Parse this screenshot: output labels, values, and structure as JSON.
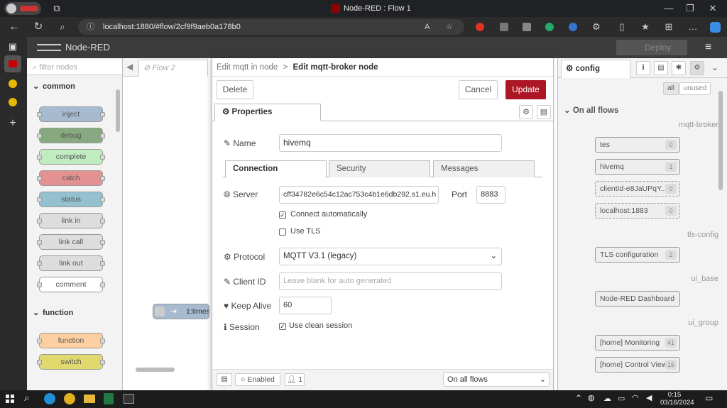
{
  "browser": {
    "title": "Node-RED : Flow 1",
    "url": "localhost:1880/#flow/2cf9f9aeb0a178b0",
    "colors": {
      "chrome": "#202124"
    }
  },
  "header": {
    "app_name": "Node-RED",
    "deploy_label": "Deploy"
  },
  "palette": {
    "filter_placeholder": "filter nodes",
    "categories": [
      "common",
      "function"
    ],
    "common_nodes": [
      {
        "label": "inject",
        "color": "#a6bbcf"
      },
      {
        "label": "debug",
        "color": "#87a980"
      },
      {
        "label": "complete",
        "color": "#c0edc0"
      },
      {
        "label": "catch",
        "color": "#e49191"
      },
      {
        "label": "status",
        "color": "#94c1d0"
      },
      {
        "label": "link in",
        "color": "#dddddd"
      },
      {
        "label": "link call",
        "color": "#dddddd"
      },
      {
        "label": "link out",
        "color": "#dddddd"
      },
      {
        "label": "comment",
        "color": "#ffffff"
      }
    ],
    "function_nodes": [
      {
        "label": "function",
        "color": "#fdd0a2"
      },
      {
        "label": "switch",
        "color": "#e2d96e"
      }
    ]
  },
  "workspace": {
    "tab_label": "Flow 2",
    "node_label": "1:times"
  },
  "tray": {
    "breadcrumb_parent": "Edit mqtt in node",
    "breadcrumb_sep": ">",
    "breadcrumb_current": "Edit mqtt-broker node",
    "delete_label": "Delete",
    "cancel_label": "Cancel",
    "update_label": "Update",
    "properties_tab": "Properties",
    "name_label": "Name",
    "name_value": "hivemq",
    "tabs": [
      "Connection",
      "Security",
      "Messages"
    ],
    "server_label": "Server",
    "server_value": "cff34782e6c54c12ac753c4b1e6db292.s1.eu.h",
    "port_label": "Port",
    "port_value": "8883",
    "connect_auto_label": "Connect automatically",
    "use_tls_label": "Use TLS",
    "protocol_label": "Protocol",
    "protocol_value": "MQTT V3.1 (legacy)",
    "client_id_label": "Client ID",
    "client_id_placeholder": "Leave blank for auto generated",
    "keep_alive_label": "Keep Alive",
    "keep_alive_value": "60",
    "session_label": "Session",
    "clean_session_label": "Use clean session",
    "footer": {
      "enabled_label": "Enabled",
      "users_count": "1",
      "scope": "On all flows"
    }
  },
  "sidebar": {
    "tab_label": "config",
    "filter_all": "all",
    "filter_unused": "unused",
    "section_title": "On all flows",
    "groups": [
      {
        "name": "mqtt-broker",
        "nodes": [
          {
            "label": "tes",
            "count": "0",
            "dashed": false
          },
          {
            "label": "hivemq",
            "count": "1",
            "dashed": false
          },
          {
            "label": "clientId-e8JaUPqY...",
            "count": "0",
            "dashed": true
          },
          {
            "label": "localhost:1883",
            "count": "0",
            "dashed": true
          }
        ]
      },
      {
        "name": "tls-config",
        "nodes": [
          {
            "label": "TLS configuration",
            "count": "2",
            "dashed": false
          }
        ]
      },
      {
        "name": "ui_base",
        "nodes": [
          {
            "label": "Node-RED Dashboard",
            "count": "",
            "dashed": false
          }
        ]
      },
      {
        "name": "ui_group",
        "nodes": [
          {
            "label": "[home] Monitoring",
            "count": "41",
            "dashed": false
          },
          {
            "label": "[home] Control View",
            "count": "15",
            "dashed": false
          }
        ]
      }
    ]
  },
  "taskbar": {
    "time": "0:15",
    "date": "03/16/2024"
  }
}
